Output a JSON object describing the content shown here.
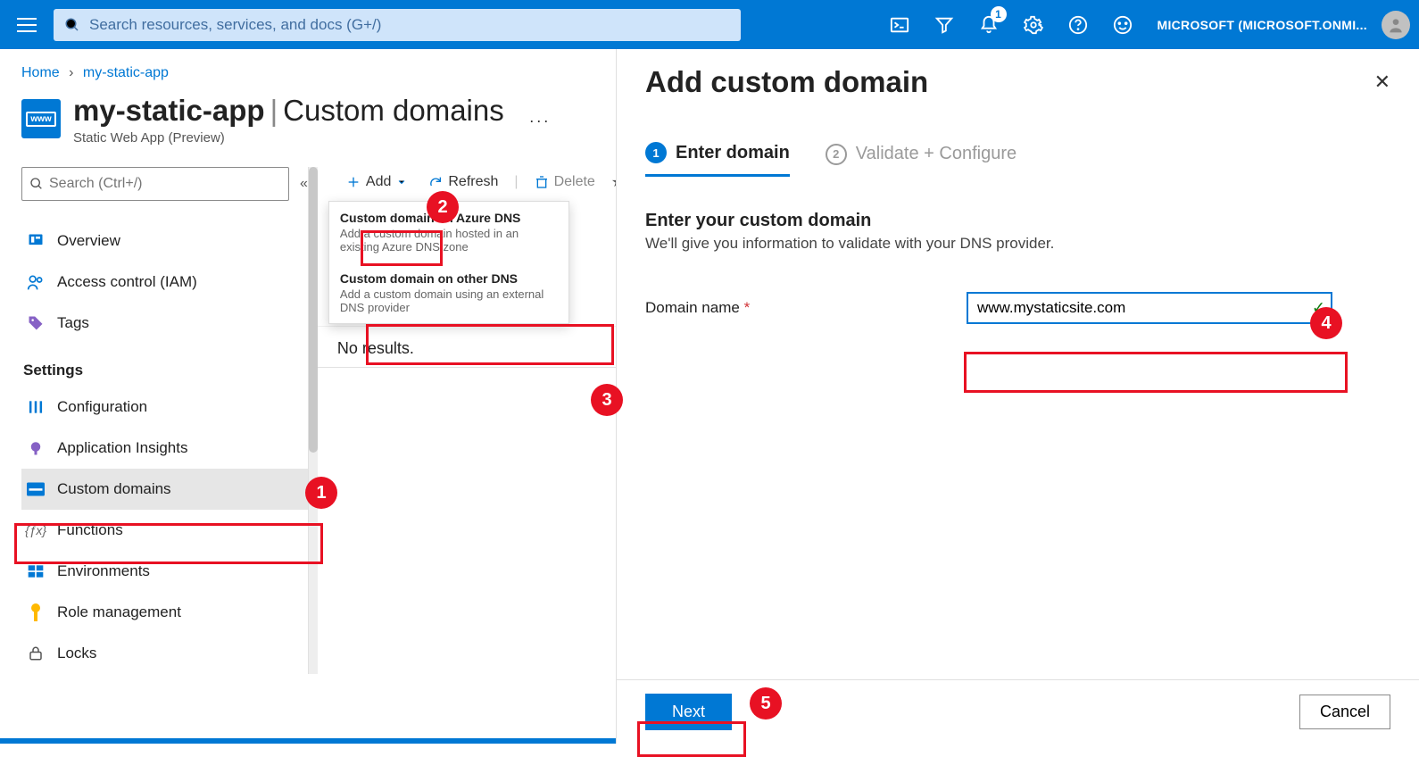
{
  "topbar": {
    "search_placeholder": "Search resources, services, and docs (G+/)",
    "notification_count": "1",
    "account_name": "MICROSOFT (MICROSOFT.ONMI..."
  },
  "breadcrumb": {
    "home": "Home",
    "current": "my-static-app"
  },
  "page": {
    "resource_name": "my-static-app",
    "section": "Custom domains",
    "subtitle": "Static Web App (Preview)"
  },
  "sidebar": {
    "search_placeholder": "Search (Ctrl+/)",
    "items_top": [
      {
        "label": "Overview"
      },
      {
        "label": "Access control (IAM)"
      },
      {
        "label": "Tags"
      }
    ],
    "section_title": "Settings",
    "items_settings": [
      {
        "label": "Configuration"
      },
      {
        "label": "Application Insights"
      },
      {
        "label": "Custom domains"
      },
      {
        "label": "Functions"
      },
      {
        "label": "Environments"
      },
      {
        "label": "Role management"
      },
      {
        "label": "Locks"
      }
    ]
  },
  "toolbar": {
    "add": "Add",
    "refresh": "Refresh",
    "delete": "Delete"
  },
  "dropdown": {
    "opt1_title": "Custom domain on Azure DNS",
    "opt1_desc": "Add a custom domain hosted in an existing Azure DNS zone",
    "opt2_title": "Custom domain on other DNS",
    "opt2_desc": "Add a custom domain using an external DNS provider"
  },
  "body": {
    "no_results": "No results."
  },
  "panel": {
    "title": "Add custom domain",
    "step1": "Enter domain",
    "step2": "Validate + Configure",
    "field_title": "Enter your custom domain",
    "field_help": "We'll give you information to validate with your DNS provider.",
    "domain_label": "Domain name",
    "domain_value": "www.mystaticsite.com",
    "next": "Next",
    "cancel": "Cancel"
  },
  "callouts": {
    "1": "1",
    "2": "2",
    "3": "3",
    "4": "4",
    "5": "5"
  }
}
